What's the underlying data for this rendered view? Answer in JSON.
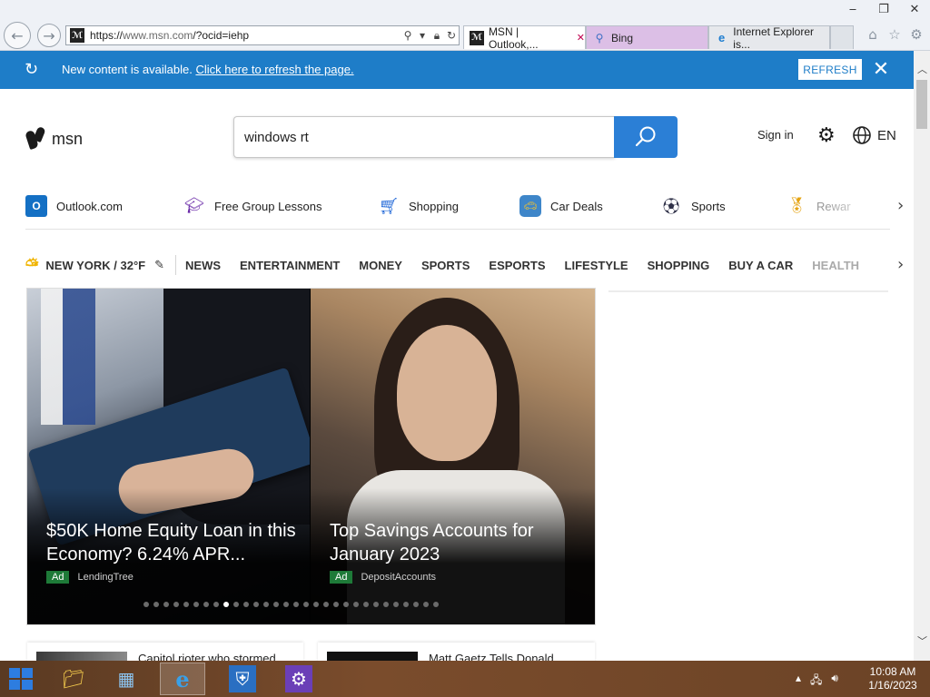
{
  "browser": {
    "url_prefix": "https://",
    "url_host": "www.msn.com",
    "url_path": "/?ocid=iehp",
    "tabs": [
      {
        "label": "MSN | Outlook,..."
      },
      {
        "label": "Bing"
      },
      {
        "label": "Internet Explorer is..."
      }
    ]
  },
  "notification": {
    "text": "New content is available.",
    "link": "Click here to refresh the page.",
    "refresh_label": "REFRESH"
  },
  "header": {
    "logo_text": "msn",
    "search_value": "windows rt",
    "sign_in": "Sign in",
    "language": "EN"
  },
  "quicklinks": [
    {
      "label": "Outlook.com",
      "icon": "outlook-icon"
    },
    {
      "label": "Free Group Lessons",
      "icon": "graduation-cap-icon"
    },
    {
      "label": "Shopping",
      "icon": "shopping-cart-icon"
    },
    {
      "label": "Car Deals",
      "icon": "car-icon"
    },
    {
      "label": "Sports",
      "icon": "soccer-ball-icon"
    },
    {
      "label": "Rewar",
      "icon": "medal-icon"
    }
  ],
  "weather": {
    "label": "NEW YORK / 32°F"
  },
  "categories": [
    "NEWS",
    "ENTERTAINMENT",
    "MONEY",
    "SPORTS",
    "ESPORTS",
    "LIFESTYLE",
    "SHOPPING",
    "BUY A CAR",
    "HEALTH"
  ],
  "hero": {
    "slides": [
      {
        "title": "$50K Home Equity Loan in this Economy? 6.24% APR...",
        "badge": "Ad",
        "source": "LendingTree"
      },
      {
        "title": "Top Savings Accounts for January 2023",
        "badge": "Ad",
        "source": "DepositAccounts"
      }
    ],
    "dot_count": 30,
    "active_dot": 8
  },
  "cards": [
    {
      "headline": "Capitol rioter who stormed"
    },
    {
      "headline": "Matt Gaetz Tells Donald"
    }
  ],
  "taskbar": {
    "time": "10:08 AM",
    "date": "1/16/2023"
  },
  "colors": {
    "accent": "#1e7dc8",
    "search_button": "#2b7fd6",
    "ad_badge": "#1e7a38",
    "taskbar": "#6b4326"
  }
}
